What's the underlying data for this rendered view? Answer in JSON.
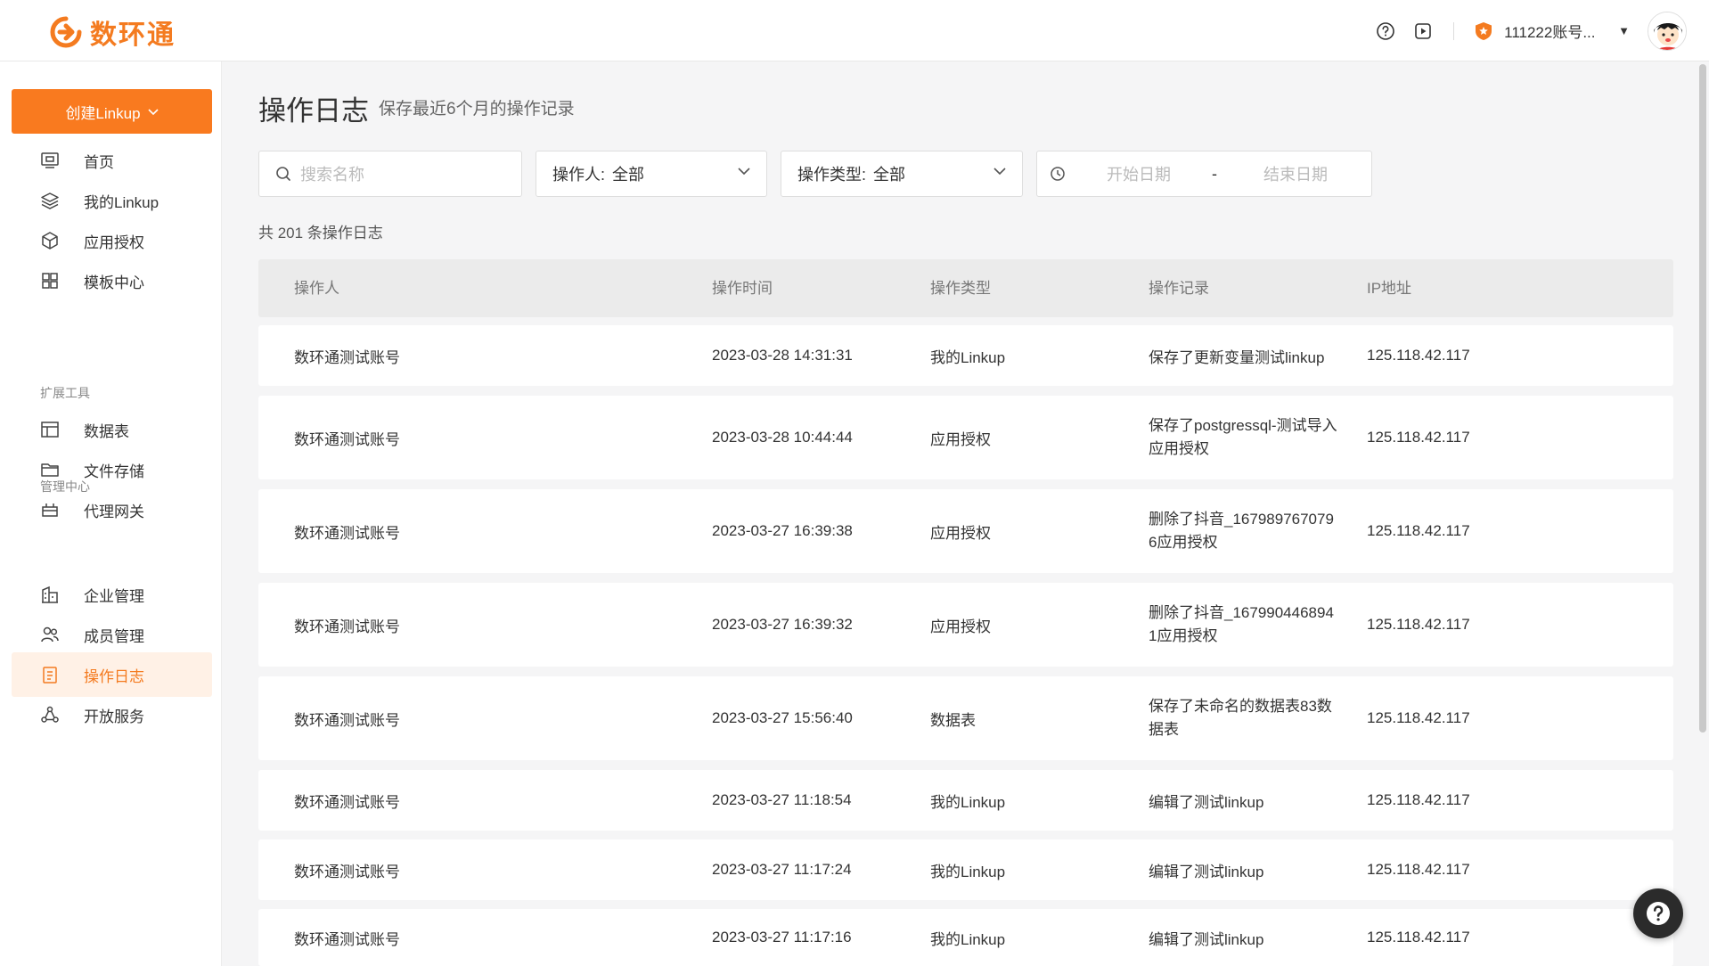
{
  "header": {
    "brand": "数环通",
    "account_name": "111222账号...",
    "icons": [
      "help-circle-icon",
      "play-icon",
      "shield-badge-icon"
    ]
  },
  "sidebar": {
    "create_label": "创建Linkup",
    "items_main": [
      {
        "label": "首页",
        "icon": "monitor-icon"
      },
      {
        "label": "我的Linkup",
        "icon": "layers-icon"
      },
      {
        "label": "应用授权",
        "icon": "cube-icon"
      },
      {
        "label": "模板中心",
        "icon": "grid-icon"
      }
    ],
    "section_tools": "扩展工具",
    "items_tools": [
      {
        "label": "数据表",
        "icon": "table-icon"
      },
      {
        "label": "文件存储",
        "icon": "folder-icon"
      },
      {
        "label": "代理网关",
        "icon": "gateway-icon"
      }
    ],
    "section_admin": "管理中心",
    "items_admin": [
      {
        "label": "企业管理",
        "icon": "building-icon"
      },
      {
        "label": "成员管理",
        "icon": "users-icon"
      },
      {
        "label": "操作日志",
        "icon": "clipboard-icon",
        "active": true
      },
      {
        "label": "开放服务",
        "icon": "share-icon"
      }
    ]
  },
  "page": {
    "title": "操作日志",
    "subtitle": "保存最近6个月的操作记录",
    "search_placeholder": "搜索名称",
    "operator_label": "操作人:",
    "operator_value": "全部",
    "type_label": "操作类型:",
    "type_value": "全部",
    "start_placeholder": "开始日期",
    "date_sep": "-",
    "end_placeholder": "结束日期",
    "total": "共 201 条操作日志"
  },
  "table": {
    "columns": [
      "操作人",
      "操作时间",
      "操作类型",
      "操作记录",
      "IP地址"
    ],
    "rows": [
      {
        "operator": "数环通测试账号",
        "time": "2023-03-28 14:31:31",
        "type": "我的Linkup",
        "record": "保存了更新变量测试linkup",
        "ip": "125.118.42.117"
      },
      {
        "operator": "数环通测试账号",
        "time": "2023-03-28 10:44:44",
        "type": "应用授权",
        "record": "保存了postgressql-测试导入应用授权",
        "ip": "125.118.42.117"
      },
      {
        "operator": "数环通测试账号",
        "time": "2023-03-27 16:39:38",
        "type": "应用授权",
        "record": "删除了抖音_1679897670796应用授权",
        "ip": "125.118.42.117"
      },
      {
        "operator": "数环通测试账号",
        "time": "2023-03-27 16:39:32",
        "type": "应用授权",
        "record": "删除了抖音_1679904468941应用授权",
        "ip": "125.118.42.117"
      },
      {
        "operator": "数环通测试账号",
        "time": "2023-03-27 15:56:40",
        "type": "数据表",
        "record": "保存了未命名的数据表83数据表",
        "ip": "125.118.42.117"
      },
      {
        "operator": "数环通测试账号",
        "time": "2023-03-27 11:18:54",
        "type": "我的Linkup",
        "record": "编辑了测试linkup",
        "ip": "125.118.42.117"
      },
      {
        "operator": "数环通测试账号",
        "time": "2023-03-27 11:17:24",
        "type": "我的Linkup",
        "record": "编辑了测试linkup",
        "ip": "125.118.42.117"
      },
      {
        "operator": "数环通测试账号",
        "time": "2023-03-27 11:17:16",
        "type": "我的Linkup",
        "record": "编辑了测试linkup",
        "ip": "125.118.42.117"
      }
    ]
  },
  "colors": {
    "accent": "#f97a1f",
    "active_bg": "#fff1e6"
  }
}
